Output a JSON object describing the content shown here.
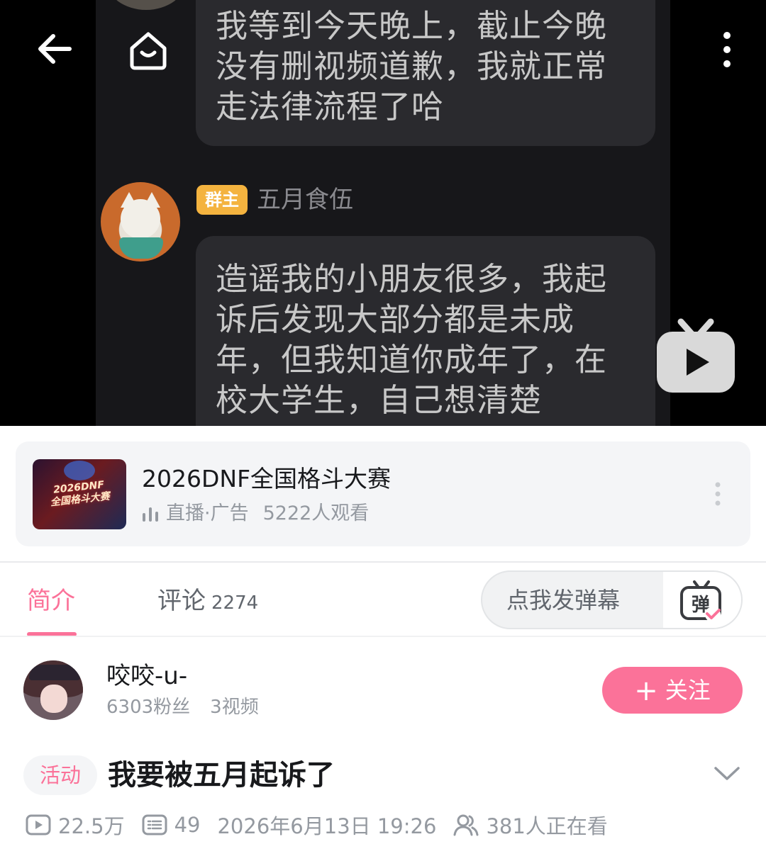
{
  "video": {
    "bubble1_lines": [
      "我等到今天晚上，截止今晚",
      "没有删视频道歉，我就正常",
      "走法律流程了哈"
    ],
    "owner_tag": "群主",
    "owner_name": "五月食伍",
    "bubble2_lines": [
      "造谣我的小朋友很多，我起",
      "诉后发现大部分都是未成",
      "年，但我知道你成年了，在",
      "校大学生，自己想清楚"
    ]
  },
  "ad": {
    "title": "2026DNF全国格斗大赛",
    "thumb_text_line1": "2026DNF",
    "thumb_text_line2": "全国格斗大赛",
    "label": "直播·广告",
    "viewers": "5222人观看"
  },
  "tabs": {
    "intro": "简介",
    "comments": "评论",
    "comments_count": "2274"
  },
  "danmaku": {
    "placeholder": "点我发弹幕",
    "icon_char": "弹"
  },
  "uploader": {
    "name": "咬咬-u-",
    "fans": "6303粉丝",
    "videos": "3视频",
    "follow_label": "关注"
  },
  "title": {
    "tag": "活动",
    "text": "我要被五月起诉了"
  },
  "meta": {
    "plays": "22.5万",
    "danmaku_count": "49",
    "datetime": "2026年6月13日 19:26",
    "watching": "381人正在看"
  },
  "colors": {
    "accent": "#fb7299",
    "owner_tag": "#f4b33f",
    "muted": "#9499a0"
  }
}
